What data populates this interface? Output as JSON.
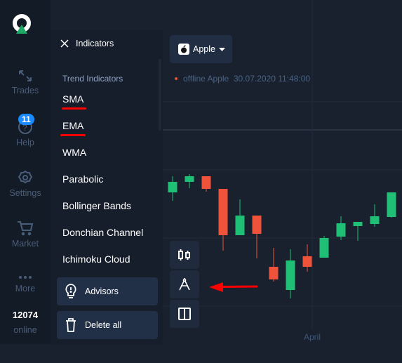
{
  "sidebar": {
    "items": [
      {
        "label": "Trades",
        "icon": "trades-arrows-icon"
      },
      {
        "label": "Help",
        "icon": "help-icon",
        "badge": "11"
      },
      {
        "label": "Settings",
        "icon": "gear-icon"
      },
      {
        "label": "Market",
        "icon": "cart-icon"
      },
      {
        "label": "More",
        "icon": "more-dots-icon"
      }
    ],
    "online_count": "12074",
    "online_label": "online"
  },
  "panel": {
    "title": "Indicators",
    "section": "Trend Indicators",
    "items": [
      "SMA",
      "EMA",
      "WMA",
      "Parabolic",
      "Bollinger Bands",
      "Donchian Channel",
      "Ichimoku Cloud"
    ],
    "underlined": [
      "SMA",
      "EMA"
    ],
    "advisors": "Advisors",
    "delete_all": "Delete all"
  },
  "chart": {
    "asset": "Apple",
    "status": "offline",
    "status_asset": "Apple",
    "timestamp": "30.07.2020 11:48:00",
    "x_label": "April",
    "colors": {
      "up": "#1fbf75",
      "down": "#f0533a",
      "background": "#19212e"
    },
    "candles": [
      {
        "o": 226,
        "c": 241,
        "h": 249,
        "l": 214
      },
      {
        "o": 241,
        "c": 249,
        "h": 252,
        "l": 232
      },
      {
        "o": 249,
        "c": 231,
        "h": 249,
        "l": 227
      },
      {
        "o": 231,
        "c": 165,
        "h": 231,
        "l": 143
      },
      {
        "o": 165,
        "c": 193,
        "h": 216,
        "l": 165
      },
      {
        "o": 193,
        "c": 167,
        "h": 193,
        "l": 132
      },
      {
        "o": 120,
        "c": 102,
        "h": 147,
        "l": 99
      },
      {
        "o": 87,
        "c": 129,
        "h": 145,
        "l": 75
      },
      {
        "o": 135,
        "c": 120,
        "h": 152,
        "l": 113
      },
      {
        "o": 133,
        "c": 161,
        "h": 164,
        "l": 133
      },
      {
        "o": 163,
        "c": 182,
        "h": 192,
        "l": 158
      },
      {
        "o": 178,
        "c": 184,
        "h": 184,
        "l": 157
      },
      {
        "o": 181,
        "c": 192,
        "h": 209,
        "l": 177
      },
      {
        "o": 191,
        "c": 226,
        "h": 226,
        "l": 190
      }
    ]
  },
  "annotation": {
    "arrow_color": "#ff0000"
  }
}
